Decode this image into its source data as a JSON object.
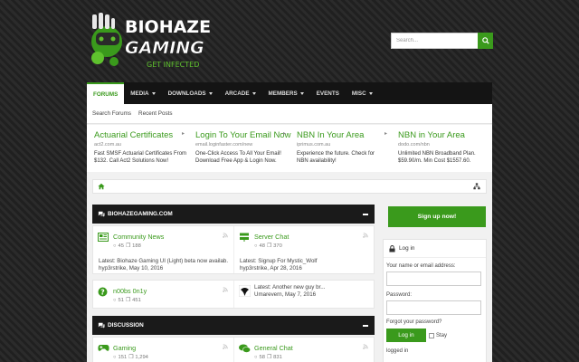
{
  "logo": {
    "line1": "BIOHAZE",
    "line2": "GAMING",
    "tagline": "GET INFECTED"
  },
  "search": {
    "placeholder": "Search..."
  },
  "nav": {
    "items": [
      {
        "label": "FORUMS",
        "dropdown": false,
        "active": true
      },
      {
        "label": "MEDIA",
        "dropdown": true
      },
      {
        "label": "DOWNLOADS",
        "dropdown": true
      },
      {
        "label": "ARCADE",
        "dropdown": true
      },
      {
        "label": "MEMBERS",
        "dropdown": true
      },
      {
        "label": "EVENTS",
        "dropdown": false
      },
      {
        "label": "MISC",
        "dropdown": true
      }
    ]
  },
  "subnav": {
    "items": [
      "Search Forums",
      "Recent Posts"
    ]
  },
  "ads": [
    {
      "title": "Actuarial Certificates",
      "url": "act2.com.au",
      "line1": "Fast SMSF Actuarial Certificates From",
      "line2": "$132. Call Act2 Solutions Now!"
    },
    {
      "title": "Login To Your Email Now",
      "url": "email.loginfaster.com/new",
      "line1": "One-Click Access To All Your Email!",
      "line2": "Download Free App & Login Now."
    },
    {
      "title": "NBN In Your Area",
      "url": "iprimus.com.au",
      "line1": "Experience the future. Check for",
      "line2": "NBN availability!"
    },
    {
      "title": "NBN in Your Area",
      "url": "dodo.com/nbn",
      "line1": "Unlimited NBN Broadband Plan.",
      "line2": "$59.90/m. Min Cost $1557.60."
    }
  ],
  "categories": [
    {
      "title": "BIOHAZEGAMING.COM",
      "rows": [
        [
          {
            "title": "Community News",
            "threads": "45",
            "messages": "188",
            "latest": "Latest: Biohaze Gaming UI (Light) beta now availab...",
            "who": "hyp3rstrike, May 10, 2016"
          },
          {
            "title": "Server Chat",
            "threads": "48",
            "messages": "370",
            "latest": "Latest: Signup For Mystic_Wolf",
            "who": "hyp3rstrike, Apr 28, 2016"
          }
        ],
        [
          {
            "title": "n00bs 0n1y",
            "threads": "51",
            "messages": "451",
            "latest": "Latest: Another new guy br...",
            "who": "Umarevern, May 7, 2016"
          }
        ]
      ]
    },
    {
      "title": "DISCUSSION",
      "rows": [
        [
          {
            "title": "Gaming",
            "threads": "151",
            "messages": "1,294"
          },
          {
            "title": "General Chat",
            "threads": "58",
            "messages": "831"
          }
        ]
      ]
    }
  ],
  "sidebar": {
    "signup": "Sign up now!",
    "login_title": "Log in",
    "name_label": "Your name or email address:",
    "password_label": "Password:",
    "forgot": "Forgot your password?",
    "login_button": "Log in",
    "stay": "Stay",
    "logged": "logged in"
  },
  "colors": {
    "accent": "#3a9a1c",
    "nav_bg": "#141414",
    "header_bg": "#1a1a1a"
  }
}
